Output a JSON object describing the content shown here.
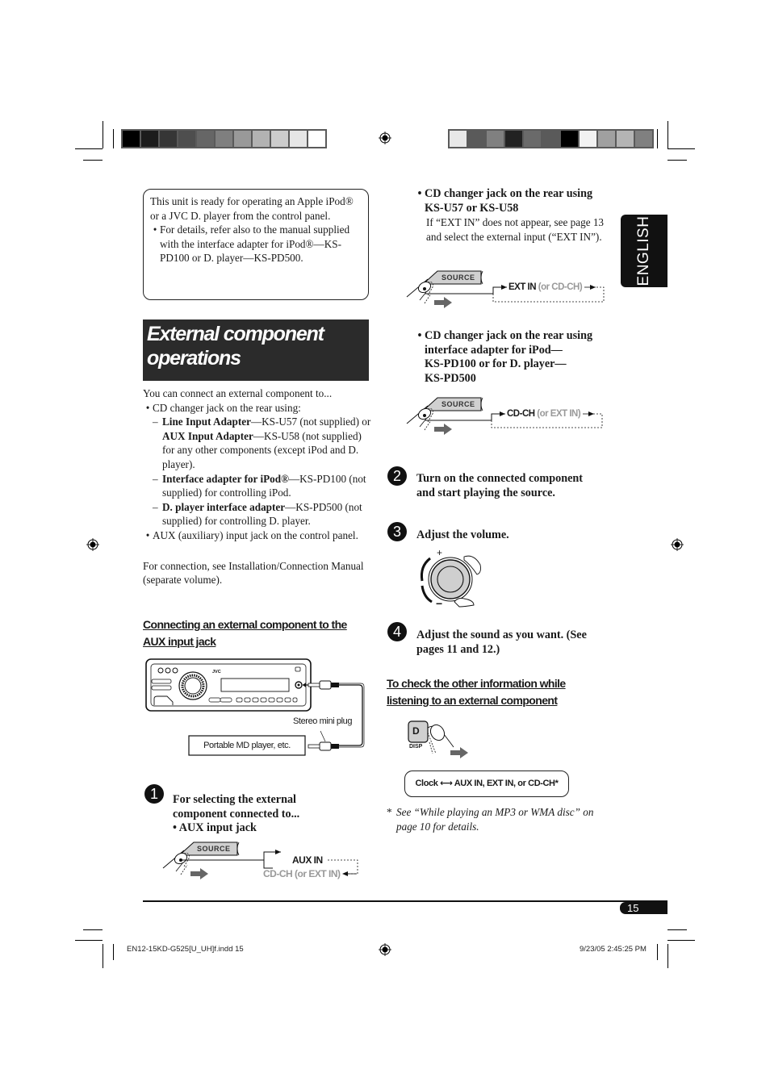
{
  "page": {
    "section_tab": "ENGLISH",
    "page_number": "15",
    "footer_left": "EN12-15KD-G525[U_UH]f.indd   15",
    "footer_right": "9/23/05   2:45:25 PM"
  },
  "color_bars": {
    "left": [
      "#000000",
      "#1c1c1c",
      "#363636",
      "#4e4e4e",
      "#666666",
      "#7f7f7f",
      "#999999",
      "#b2b2b2",
      "#cccccc",
      "#e6e6e6",
      "#ffffff"
    ],
    "right": [
      "#e8e8e8",
      "#5a5a5a",
      "#808080",
      "#222222",
      "#6a6a6a",
      "#5a5a5a",
      "#000000",
      "#f2f2f2",
      "#a0a0a0",
      "#b4b4b4",
      "#808080"
    ]
  },
  "note_box": {
    "text": "This unit is ready for operating an Apple iPod® or a JVC D. player from the control panel.",
    "bullet": "For details, refer also to the manual supplied with the interface adapter for iPod®—KS-PD100 or D. player—KS-PD500."
  },
  "title": {
    "line1": "External component",
    "line2": "operations"
  },
  "intro": {
    "lead": "You can connect an external component to...",
    "items": [
      {
        "text": "CD changer jack on the rear using:",
        "subitems": [
          {
            "bold1": "Line Input Adapter",
            "text1": "—KS-U57 (not supplied) or ",
            "bold2": "AUX Input Adapter",
            "text2": "—KS-U58 (not supplied) for any other components (except iPod and D. player)."
          },
          {
            "bold1": "Interface adapter for iPod®",
            "text1": "—KS-PD100 (not supplied) for controlling iPod.",
            "bold2": "",
            "text2": ""
          },
          {
            "bold1": "D. player interface adapter",
            "text1": "—KS-PD500 (not supplied) for controlling D. player.",
            "bold2": "",
            "text2": ""
          }
        ]
      },
      {
        "text": "AUX (auxiliary) input jack on the control panel.",
        "subitems": []
      }
    ],
    "connection_note": "For connection, see Installation/Connection Manual (separate volume)."
  },
  "aux_section": {
    "heading_line1": "Connecting an external component to the",
    "heading_line2": "AUX input jack",
    "brand": "JVC",
    "plug_label": "Stereo mini plug",
    "device_label": "Portable MD player, etc."
  },
  "steps": [
    {
      "num": "1",
      "line1": "For selecting the external",
      "line2": "component connected to...",
      "bullet": "AUX input jack",
      "diagram": {
        "button": "SOURCE",
        "primary": "AUX IN",
        "secondary": "CD-CH  (or EXT IN)"
      }
    },
    {
      "num": "2",
      "line1": "Turn on the connected component",
      "line2": "and start playing the source."
    },
    {
      "num": "3",
      "line1": "Adjust the volume.",
      "plus": "+",
      "minus": "−"
    },
    {
      "num": "4",
      "line1": "Adjust the sound as you want. (See",
      "line2": "pages 11 and 12.)"
    }
  ],
  "right_col": {
    "item_a": {
      "line1": "CD changer jack on the rear using",
      "line2": "KS-U57 or KS-U58",
      "note": "If “EXT IN” does not appear, see page 13 and select the external input (“EXT IN”).",
      "diagram": {
        "button": "SOURCE",
        "primary": "EXT IN",
        "secondary": "(or CD-CH)"
      }
    },
    "item_b": {
      "line1": "CD changer jack on the rear using",
      "line2": "interface adapter for iPod—",
      "line3": "KS-PD100 or for D. player—",
      "line4": "KS-PD500",
      "diagram": {
        "button": "SOURCE",
        "primary": "CD-CH",
        "secondary": "(or EXT IN)"
      }
    }
  },
  "check_section": {
    "heading_line1": "To check the other information while",
    "heading_line2": "listening to an external component",
    "button_letter": "D",
    "button_label": "DISP",
    "cycle_left": "Clock",
    "cycle_right": "AUX IN, EXT IN, or CD-CH*",
    "footnote_mark": "*",
    "footnote": "See “While playing an MP3 or WMA disc” on page 10 for details."
  }
}
